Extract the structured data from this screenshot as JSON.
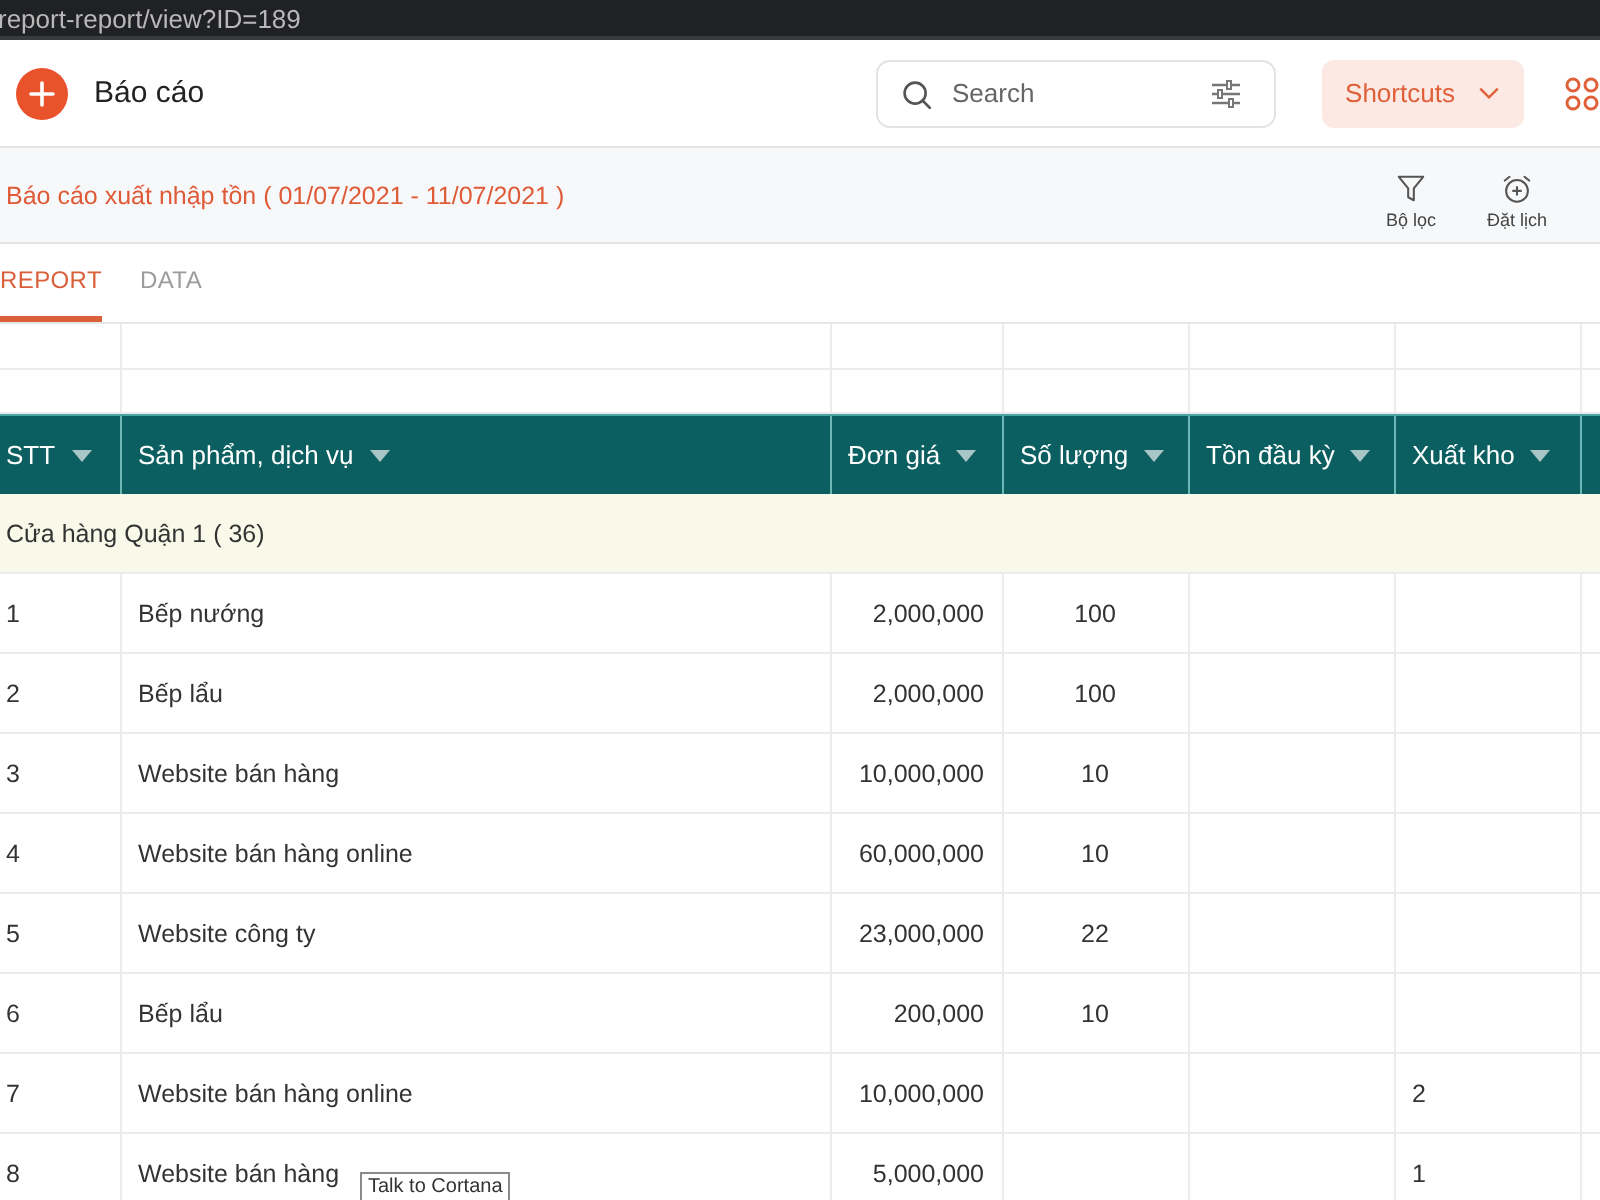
{
  "browser": {
    "url": "report-report/view?ID=189"
  },
  "header": {
    "title": "Báo cáo",
    "search": {
      "placeholder": "Search"
    },
    "shortcuts_button": "Shortcuts"
  },
  "report_bar": {
    "title": "Báo cáo xuất nhập tồn ( 01/07/2021 - 11/07/2021 )",
    "actions": [
      {
        "kind": "filter",
        "label": "Bộ lọc"
      },
      {
        "kind": "schedule",
        "label": "Đặt lịch"
      }
    ]
  },
  "tabs": [
    {
      "label": "REPORT",
      "selected": true
    },
    {
      "label": "DATA",
      "selected": false
    }
  ],
  "table": {
    "columns": [
      "STT",
      "Sản phẩm, dịch vụ",
      "Đơn giá",
      "Số lượng",
      "Tồn đầu kỳ",
      "Xuất kho"
    ],
    "group": "Cửa hàng Quận 1 ( 36)",
    "rows": [
      {
        "stt": "1",
        "product": "Bếp nướng",
        "unit_price": "2,000,000",
        "quantity": "100"
      },
      {
        "stt": "2",
        "product": "Bếp lẩu",
        "unit_price": "2,000,000",
        "quantity": "100"
      },
      {
        "stt": "3",
        "product": "Website bán hàng",
        "unit_price": "10,000,000",
        "quantity": "10"
      },
      {
        "stt": "4",
        "product": "Website bán hàng online",
        "unit_price": "60,000,000",
        "quantity": "10"
      },
      {
        "stt": "5",
        "product": "Website công ty",
        "unit_price": "23,000,000",
        "quantity": "22"
      },
      {
        "stt": "6",
        "product": "Bếp lẩu",
        "unit_price": "200,000",
        "quantity": "10"
      },
      {
        "stt": "7",
        "product": "Website bán hàng online",
        "unit_price": "10,000,000",
        "stock_out": "2"
      },
      {
        "stt": "8",
        "product": "Website bán hàng",
        "unit_price": "5,000,000",
        "stock_out": "1"
      }
    ]
  },
  "tooltip": "Talk to Cortana"
}
